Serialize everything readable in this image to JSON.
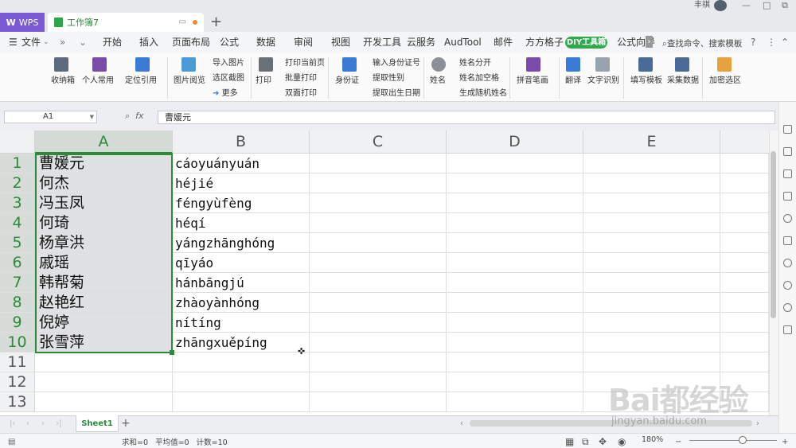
{
  "titlebar": {
    "wps_tab": "WPS",
    "book_tab": "工作簿7",
    "new_tab": "+",
    "user_name": "丰祺",
    "win_buttons": [
      "—",
      "□",
      "⧉"
    ]
  },
  "menu": {
    "file": "文件",
    "items": [
      "开始",
      "插入",
      "页面布局",
      "公式",
      "数据",
      "审阅",
      "视图",
      "开发工具",
      "云服务",
      "AudTool",
      "邮件",
      "方方格子"
    ],
    "diy": "DIY工具箱",
    "formula_wizard": "公式向导",
    "search": "查找命令、搜索模板",
    "more": "›"
  },
  "ribbon": {
    "buttons": [
      "收纳箱",
      "个人常用",
      "定位引用",
      "图片阅览",
      "导入图片",
      "选区截图",
      "更多",
      "打印",
      "打印当前页",
      "批量打印",
      "双面打印",
      "身份证",
      "输入身份证号",
      "提取性别",
      "提取出生日期",
      "姓名",
      "姓名分开",
      "姓名加空格",
      "生成随机姓名",
      "拼音笔画",
      "翻译",
      "文字识别",
      "填写模板",
      "采集数据",
      "加密选区"
    ]
  },
  "formula_bar": {
    "name_box": "A1",
    "fx": "fx",
    "value": "曹媛元"
  },
  "columns": [
    "A",
    "B",
    "C",
    "D",
    "E"
  ],
  "rows": [
    {
      "num": "1",
      "a": "曹媛元",
      "b": "cáoyuányuán"
    },
    {
      "num": "2",
      "a": "何杰",
      "b": "héjié"
    },
    {
      "num": "3",
      "a": "冯玉凤",
      "b": "féngyùfèng"
    },
    {
      "num": "4",
      "a": "何琦",
      "b": "héqí"
    },
    {
      "num": "5",
      "a": "杨章洪",
      "b": "yángzhānghóng"
    },
    {
      "num": "6",
      "a": "戚瑶",
      "b": "qīyáo"
    },
    {
      "num": "7",
      "a": "韩帮菊",
      "b": "hánbāngjú"
    },
    {
      "num": "8",
      "a": "赵艳红",
      "b": "zhàoyànhóng"
    },
    {
      "num": "9",
      "a": "倪婷",
      "b": "nítíng"
    },
    {
      "num": "10",
      "a": "张雪萍",
      "b": "zhāngxuěpíng"
    },
    {
      "num": "11",
      "a": "",
      "b": ""
    },
    {
      "num": "12",
      "a": "",
      "b": ""
    },
    {
      "num": "13",
      "a": "",
      "b": ""
    }
  ],
  "sheets": {
    "active": "Sheet1",
    "add": "+"
  },
  "status": {
    "sum": "求和=0",
    "avg": "平均值=0",
    "count": "计数=10",
    "zoom": "180%"
  },
  "watermark": {
    "big": "Bai都经验",
    "sub": "jingyan.baidu.com"
  },
  "colors": {
    "accent": "#2c8a3b",
    "wps": "#7b5ad6",
    "diy": "#2ea94d"
  }
}
